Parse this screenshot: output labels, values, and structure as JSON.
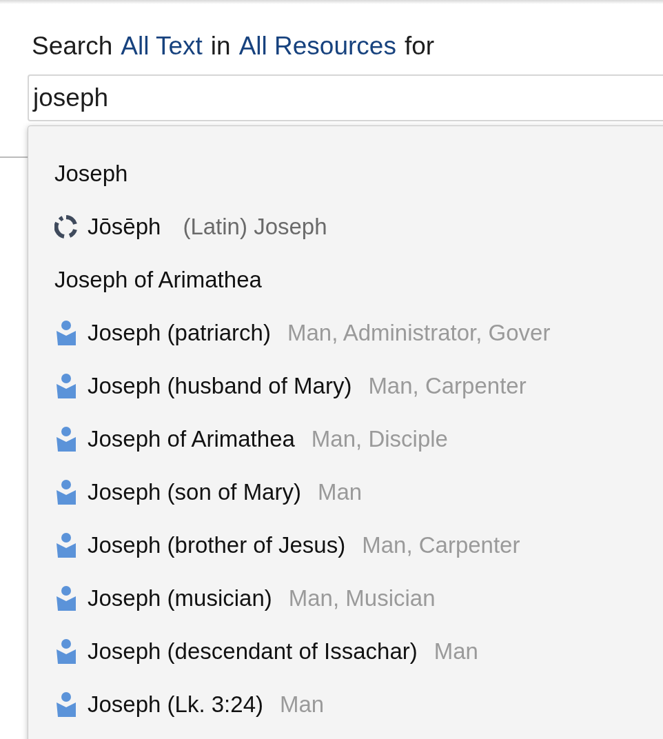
{
  "search_bar": {
    "prefix": "Search",
    "scope": "All Text",
    "connector": "in",
    "source": "All Resources",
    "suffix": "for",
    "query": "joseph"
  },
  "suggestions": [
    {
      "kind": "heading",
      "label": "Joseph"
    },
    {
      "kind": "lemma",
      "label": "Jōsēph",
      "detail": "(Latin) Joseph"
    },
    {
      "kind": "heading",
      "label": "Joseph of Arimathea"
    },
    {
      "kind": "person",
      "label": "Joseph (patriarch)",
      "detail": "Man, Administrator, Gover"
    },
    {
      "kind": "person",
      "label": "Joseph (husband of Mary)",
      "detail": "Man, Carpenter"
    },
    {
      "kind": "person",
      "label": "Joseph of Arimathea",
      "detail": "Man, Disciple"
    },
    {
      "kind": "person",
      "label": "Joseph (son of Mary)",
      "detail": "Man"
    },
    {
      "kind": "person",
      "label": "Joseph (brother of Jesus)",
      "detail": "Man, Carpenter"
    },
    {
      "kind": "person",
      "label": "Joseph (musician)",
      "detail": "Man, Musician"
    },
    {
      "kind": "person",
      "label": "Joseph (descendant of Issachar)",
      "detail": "Man"
    },
    {
      "kind": "person",
      "label": "Joseph (Lk. 3:24)",
      "detail": "Man"
    }
  ]
}
